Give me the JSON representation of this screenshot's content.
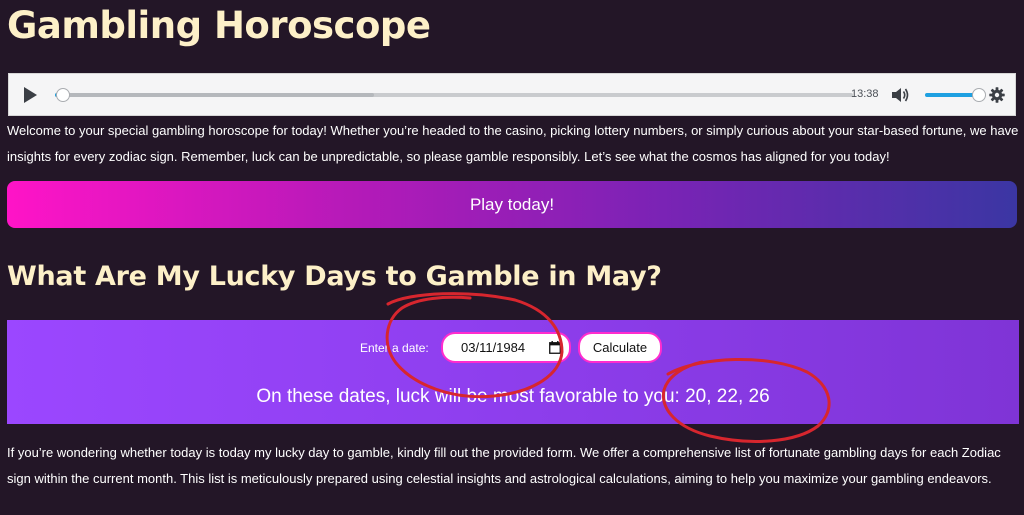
{
  "page": {
    "title": "Gambling Horoscope"
  },
  "audio_player": {
    "time": "13:38",
    "progress": 0.01,
    "buffered": 0.4,
    "volume": 0.85,
    "icons": [
      "play-icon",
      "volume-icon",
      "gear-icon"
    ]
  },
  "intro": {
    "text": "Welcome to your special gambling horoscope for today! Whether you’re headed to the casino, picking lottery numbers, or simply curious about your star-based fortune, we have insights for every zodiac sign. Remember, luck can be unpredictable, so please gamble responsibly. Let’s see what the cosmos has aligned for you today!"
  },
  "cta": {
    "play_label": "Play today!"
  },
  "lucky_days": {
    "heading": "What Are My Lucky Days to Gamble in May?",
    "date_label": "Enter a date:",
    "date_value": "03/11/1984",
    "calculate_label": "Calculate",
    "result_text": "On these dates, luck will be most favorable to you: 20, 22, 26"
  },
  "body": {
    "text": "If you’re wondering whether today is today my lucky day to gamble, kindly fill out the provided form. We offer a comprehensive list of fortunate gambling days for each Zodiac sign within the current month. This list is meticulously prepared using celestial insights and astrological calculations, aiming to help you maximize your gambling endeavors."
  },
  "colors": {
    "background": "#231627",
    "heading": "#fdf0c8",
    "accent_pink": "#ff2ccd",
    "panel_purple": "#9b47ff",
    "annotation_red": "#d7262e"
  }
}
